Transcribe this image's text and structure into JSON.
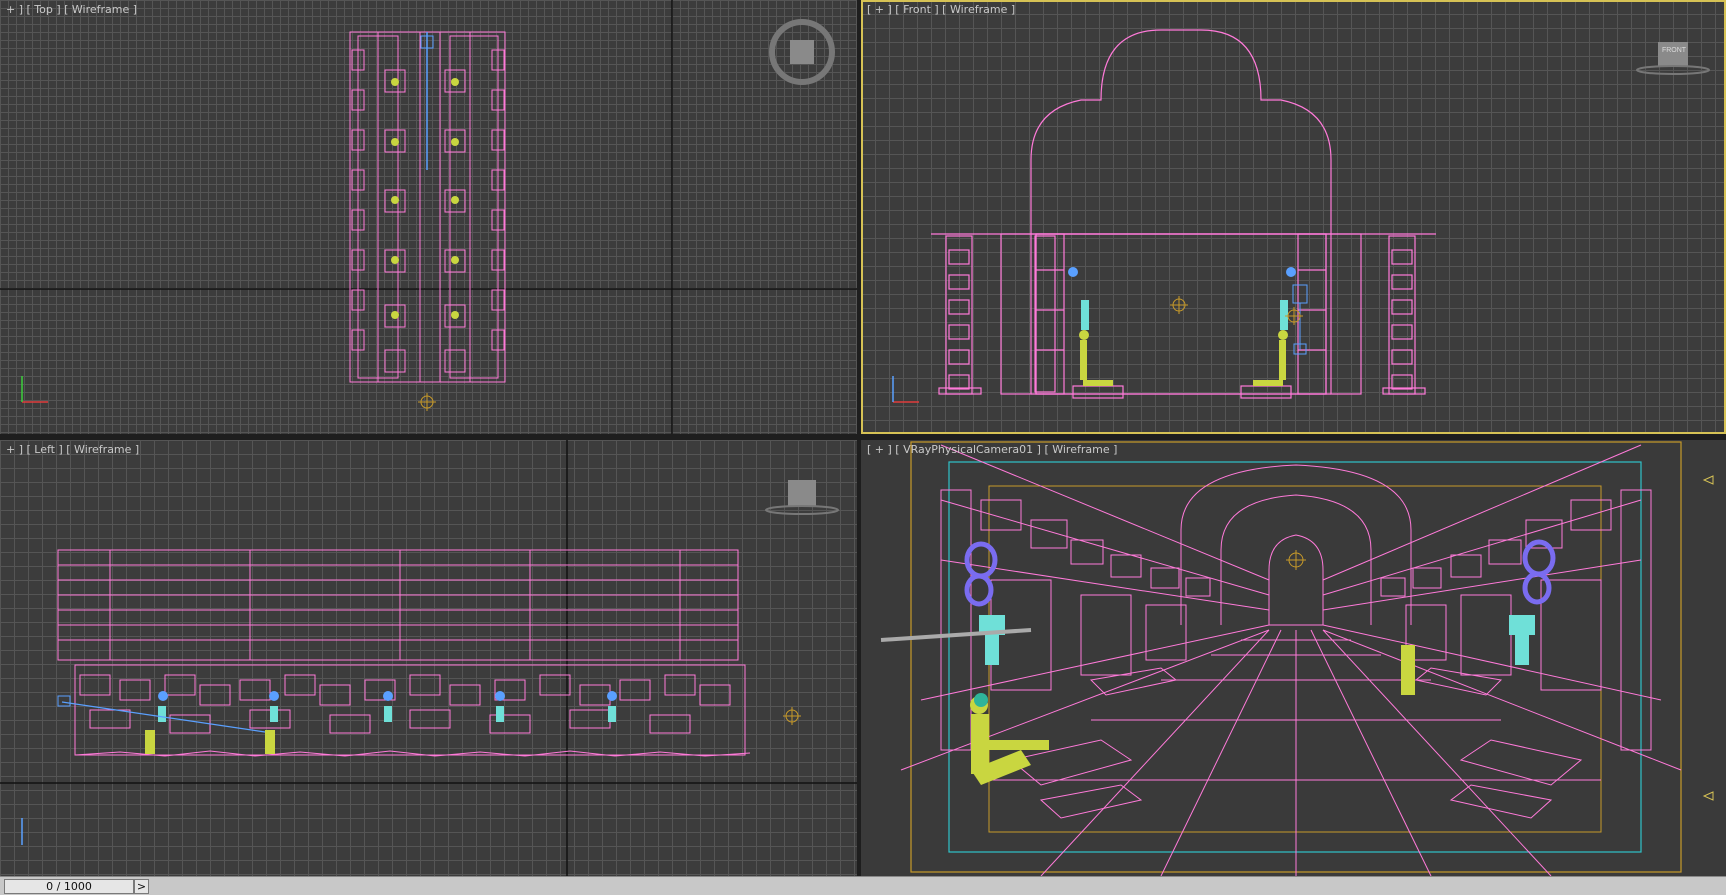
{
  "viewports": {
    "top": {
      "label": "+ ] [ Top ] [ Wireframe ]"
    },
    "front": {
      "label": "[ + ] [ Front ] [ Wireframe ]",
      "cube_text": "FRONT"
    },
    "left": {
      "label": "+ ] [ Left ] [ Wireframe ]"
    },
    "camera": {
      "label": "[ + ] [ VRayPhysicalCamera01 ] [ Wireframe ]"
    }
  },
  "timeline": {
    "frame": "0 / 1000",
    "next_label": ">"
  },
  "colors": {
    "wire": "#ff7ad9",
    "figure": "#c9d640",
    "accent": "#5aa0ff",
    "safe_frame": "#2fc3c9",
    "frame_gold": "#c79a2a",
    "active_border": "#d6c255"
  }
}
